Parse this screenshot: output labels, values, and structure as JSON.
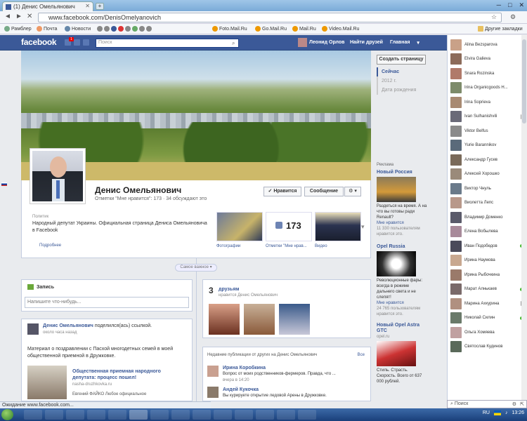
{
  "browser": {
    "tab_title": "(1) Денис Омельянович",
    "url": "www.facebook.com/DenisOmelyanovich",
    "bookmarks": [
      "Рамблер",
      "Почта",
      "Новости",
      "Foto.Mail.Ru",
      "Go.Mail.Ru",
      "Mail.Ru",
      "Video.Mail.Ru"
    ],
    "other_bookmarks": "Другие закладки",
    "status": "Ожидание www.facebook.com..."
  },
  "fb": {
    "logo": "facebook",
    "notif_count": "1",
    "search_placeholder": "Поиск",
    "user_name": "Леонид Орлов",
    "find_friends": "Найти друзей",
    "home": "Главная"
  },
  "profile": {
    "name": "Денис Омельянович",
    "likes_line": "Отметки \"Мне нравится\": 173 · 34 обсуждают это",
    "like_button": "✓ Нравится",
    "message_button": "Сообщение",
    "about_category": "Политик",
    "about_text": "Народный депутат Украины. Официальная страница Дениса Омельяновича в Facebook",
    "more": "Подробнее",
    "thumbs": [
      {
        "label": "Фотографии"
      },
      {
        "label": "Отметки \"Мне нрав...",
        "count": "173"
      },
      {
        "label": "Видео"
      }
    ],
    "show_all": "Самое важное"
  },
  "right": {
    "create_page": "Создать страницу",
    "timeline": [
      "Сейчас",
      "2012 г.",
      "Дата рождения"
    ],
    "ads_heading": "Реклама",
    "ads": [
      {
        "title": "Новый Россия",
        "text": "Раздеться на время. А на что вы готовы ради Renault?",
        "like": "Мне нравится",
        "people": "11 330 пользователям нравится это."
      },
      {
        "title": "Opel Russia",
        "text": "Революционные фары: всегда в режиме дальнего света и не слепят!",
        "like": "Мне нравится",
        "people": "24 765 пользователям нравится это."
      },
      {
        "title": "Новый Opel Astra GTC",
        "sub": "opel.ru",
        "text": "Стиль. Страсть. Скорость. Всего от 637 000 рублей."
      }
    ]
  },
  "post_box": {
    "title": "Запись",
    "placeholder": "Напишите что-нибудь..."
  },
  "post": {
    "author": "Денис Омельянович",
    "action": "поделился(ась) ссылкой.",
    "time": "около часа назад",
    "text": "Материал о поздравлении с Пасхой многодетных семей в моей общественной приемной в Дружковке.",
    "link_title": "Общественная приемная народного депутата: процесс пошел!",
    "link_domain": "nasha-druzhkovka.ru",
    "link_desc": "Евгений ФАЙКО Любое официальное"
  },
  "friends_card": {
    "count": "3",
    "title": "друзьям",
    "subtitle": "нравится Денис Омельянович"
  },
  "recent_posts": {
    "title": "Недавние публикации от других на Денис Омельянович",
    "all": "Все",
    "items": [
      {
        "name": "Ирина Коробкина",
        "text": "Вопрос от моих родственников-фермеров. Правда, что ...",
        "time": "вчера в 14:20"
      },
      {
        "name": "Андей Кукочка",
        "text": "Вы курируете открытие ледовой Арены в Дружковке.",
        "time": "20 апреля в 23:33"
      }
    ]
  },
  "chat": {
    "search": "Поиск",
    "friends": [
      {
        "name": "Alina Bezsparova",
        "state": "none",
        "color": "#c9a188"
      },
      {
        "name": "Elvira Galieva",
        "state": "none",
        "color": "#8c6b5a"
      },
      {
        "name": "Snara Rozinska",
        "state": "none",
        "color": "#b07a6a"
      },
      {
        "name": "Irina Organicgoods H...",
        "state": "none",
        "color": "#7d8b6a"
      },
      {
        "name": "Irina Soprieva",
        "state": "none",
        "color": "#a88a72"
      },
      {
        "name": "Ivan Sulhanishvili",
        "state": "mobile",
        "color": "#6a6a78"
      },
      {
        "name": "Viktor Belfus",
        "state": "none",
        "color": "#8a8a8a"
      },
      {
        "name": "Yurie Barannikov",
        "state": "none",
        "color": "#5a6a7a"
      },
      {
        "name": "Александр Гусев",
        "state": "none",
        "color": "#7a6a5a"
      },
      {
        "name": "Алексей Хорошко",
        "state": "none",
        "color": "#9a8a7a"
      },
      {
        "name": "Виктор Чнуль",
        "state": "none",
        "color": "#6a7a8a"
      },
      {
        "name": "Виолетта Лепс",
        "state": "none",
        "color": "#b8988a"
      },
      {
        "name": "Владимир Доменко",
        "state": "none",
        "color": "#5a5a6a"
      },
      {
        "name": "Елена Вобылева",
        "state": "none",
        "color": "#a88a9a"
      },
      {
        "name": "Иван Подобедов",
        "state": "online",
        "color": "#4a4a5a"
      },
      {
        "name": "Ирина Наумова",
        "state": "none",
        "color": "#c8a890"
      },
      {
        "name": "Ирина Рыбочкина",
        "state": "none",
        "color": "#9a7a6a"
      },
      {
        "name": "Марат Алнькаев",
        "state": "online",
        "color": "#7a6a6a"
      },
      {
        "name": "Марина Ахкурина",
        "state": "mobile",
        "color": "#b09080"
      },
      {
        "name": "Николай Силин",
        "state": "online",
        "color": "#6a7a6a"
      },
      {
        "name": "Ольга Хомяева",
        "state": "none",
        "color": "#c0a0a0"
      },
      {
        "name": "Святослав Кудинов",
        "state": "none",
        "color": "#5a6a5a"
      }
    ]
  },
  "taskbar": {
    "lang": "RU",
    "time": "13:26"
  }
}
